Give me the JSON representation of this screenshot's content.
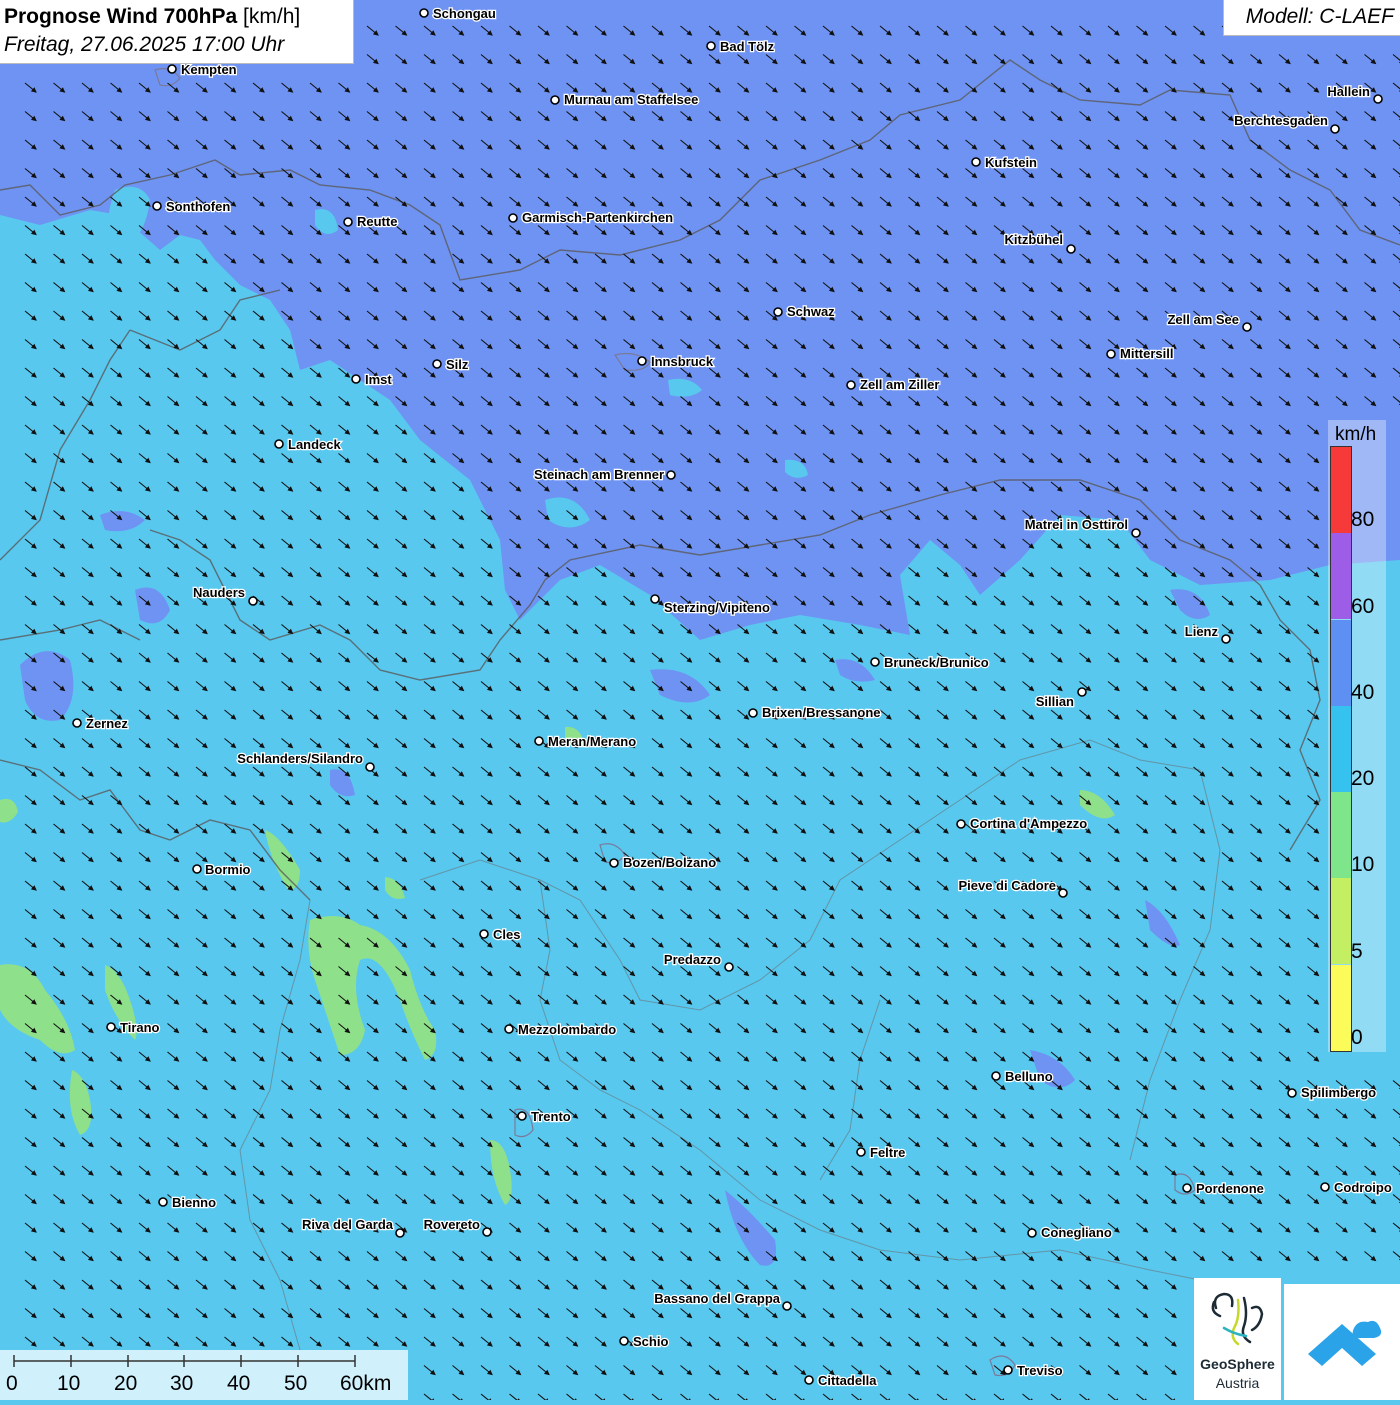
{
  "title": {
    "bold": "Prognose Wind 700hPa",
    "unit": "[km/h]",
    "datetime": "Freitag, 27.06.2025 17:00 Uhr"
  },
  "model": "Modell: C-LAEF",
  "legend": {
    "unit": "km/h",
    "bins": [
      {
        "label": "0",
        "color": "#fbfb5a"
      },
      {
        "label": "5",
        "color": "#c4ef62"
      },
      {
        "label": "10",
        "color": "#7fe58a"
      },
      {
        "label": "20",
        "color": "#36c2ef"
      },
      {
        "label": "40",
        "color": "#5e8ff3"
      },
      {
        "label": "60",
        "color": "#9d5de6"
      },
      {
        "label": "80",
        "color": "#f63a3a"
      }
    ]
  },
  "scale_bar": {
    "labels": [
      "0",
      "10",
      "20",
      "30",
      "40",
      "50",
      "60km"
    ]
  },
  "colors": {
    "wind_20_40": "#58c8ef",
    "wind_40_60": "#6f93f2",
    "wind_10_20": "#8fe08a",
    "wind_60_80": "#8a76e3",
    "arrow": "#111111",
    "border": "#5a5a5a"
  },
  "wind_direction": "northwest to southeast",
  "cities": [
    {
      "name": "Schongau"
    },
    {
      "name": "Bad Tölz"
    },
    {
      "name": "Kempten"
    },
    {
      "name": "Murnau am Staffelsee"
    },
    {
      "name": "Hallein"
    },
    {
      "name": "Berchtesgaden"
    },
    {
      "name": "Kufstein"
    },
    {
      "name": "Sonthofen"
    },
    {
      "name": "Reutte"
    },
    {
      "name": "Garmisch-Partenkirchen"
    },
    {
      "name": "Kitzbühel"
    },
    {
      "name": "Schwaz"
    },
    {
      "name": "Zell am See"
    },
    {
      "name": "Mittersill"
    },
    {
      "name": "Innsbruck"
    },
    {
      "name": "Silz"
    },
    {
      "name": "Imst"
    },
    {
      "name": "Zell am Ziller"
    },
    {
      "name": "Landeck"
    },
    {
      "name": "Steinach am Brenner"
    },
    {
      "name": "Matrei in Osttirol"
    },
    {
      "name": "Nauders"
    },
    {
      "name": "Sterzing/Vipiteno"
    },
    {
      "name": "Lienz"
    },
    {
      "name": "Bruneck/Brunico"
    },
    {
      "name": "Sillian"
    },
    {
      "name": "Brixen/Bressanone"
    },
    {
      "name": "Zernez"
    },
    {
      "name": "Meran/Merano"
    },
    {
      "name": "Schlanders/Silandro"
    },
    {
      "name": "Cortina d'Ampezzo"
    },
    {
      "name": "Bozen/Bolzano"
    },
    {
      "name": "Bormio"
    },
    {
      "name": "Pieve di Cadore"
    },
    {
      "name": "Cles"
    },
    {
      "name": "Predazzo"
    },
    {
      "name": "Tirano"
    },
    {
      "name": "Mezzolombardo"
    },
    {
      "name": "Belluno"
    },
    {
      "name": "Spilimbergo"
    },
    {
      "name": "Trento"
    },
    {
      "name": "Feltre"
    },
    {
      "name": "Bienno"
    },
    {
      "name": "Pordenone"
    },
    {
      "name": "Codroipo"
    },
    {
      "name": "Riva del Garda"
    },
    {
      "name": "Rovereto"
    },
    {
      "name": "Conegliano"
    },
    {
      "name": "Bassano del Grappa"
    },
    {
      "name": "Schio"
    },
    {
      "name": "Treviso"
    },
    {
      "name": "Cittadella"
    }
  ],
  "logos": {
    "geosphere_name": "GeoSphere",
    "geosphere_sub": "Austria"
  }
}
